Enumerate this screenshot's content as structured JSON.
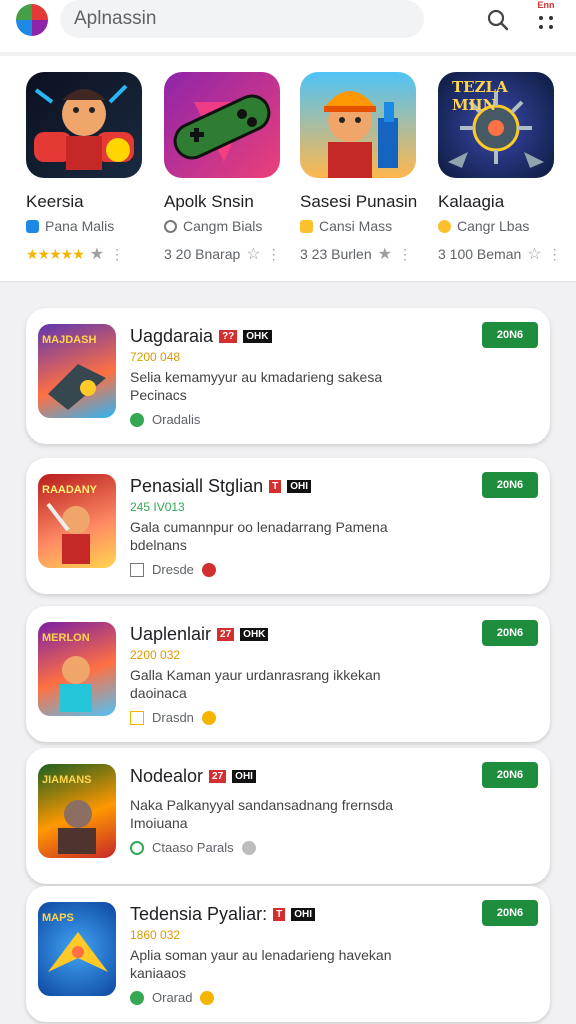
{
  "header": {
    "search_text": "Aplnassin",
    "menu_badge": "Enn",
    "icons": [
      "app-logo",
      "search-icon",
      "menu-icon"
    ]
  },
  "featured": [
    {
      "title": "Keersia",
      "developer": "Pana Malis",
      "size": "",
      "rating": 4,
      "colors": [
        "#0c1020",
        "#e53935",
        "#1e88e5"
      ]
    },
    {
      "title": "Apolk Snsin",
      "developer": "Cangm Bials",
      "size": "3 20 Bnarap",
      "rating": 0,
      "colors": [
        "#8e24aa",
        "#2e7d32",
        "#ff4081"
      ]
    },
    {
      "title": "Sasesi Punasin",
      "developer": "Cansi Mass",
      "size": "3 23 Burlen",
      "rating": 0,
      "colors": [
        "#4fc3f7",
        "#ff9800",
        "#c62828"
      ]
    },
    {
      "title": "Kalaagia",
      "developer": "Cangr Lbas",
      "size": "3 100 Beman",
      "rating": 0,
      "colors": [
        "#0d1b3e",
        "#5c6bc0",
        "#ffca28"
      ]
    }
  ],
  "list": [
    {
      "name": "Uagdaraia",
      "badge_red": "??",
      "badge_black": "OHK",
      "count": "7200 048",
      "desc": "Selia kemamyyur au kmadarieng sakesa Pecinacs",
      "sub": "Oradalis",
      "install": "20N6",
      "icon_label": "MAJDASH",
      "colors": [
        "#5e35b1",
        "#ff7043",
        "#29b6f6"
      ]
    },
    {
      "name": "Penasiall Stglian",
      "badge_red": "T",
      "badge_black": "OHI",
      "count": "245 IV013",
      "desc": "Gala cumannpur oo lenadarrang Pamena bdelnans",
      "sub": "Dresde",
      "install": "20N6",
      "icon_label": "RAADANY",
      "colors": [
        "#b71c1c",
        "#ff8a65",
        "#ffd54f"
      ]
    },
    {
      "name": "Uaplenlair",
      "badge_red": "27",
      "badge_black": "OHK",
      "count": "2200 032",
      "desc": "Galla Kaman yaur urdanrasrang ikkekan daoinaca",
      "sub": "Drasdn",
      "install": "20N6",
      "icon_label": "MERLON",
      "colors": [
        "#7b1fa2",
        "#ff7043",
        "#4fc3f7"
      ]
    },
    {
      "name": "Nodealor",
      "badge_red": "27",
      "badge_black": "OHI",
      "count": "",
      "desc": "Naka Palkanyyal sandansadnang frernsda Imoiuana",
      "sub": "Ctaaso Parals",
      "install": "20N6",
      "icon_label": "JIAMANS",
      "colors": [
        "#1b5e20",
        "#ff9800",
        "#c62828"
      ]
    },
    {
      "name": "Tedensia Pyaliar:",
      "badge_red": "T",
      "badge_black": "OHI",
      "count": "1860 032",
      "desc": "Aplia soman yaur au lenadarieng havekan kaniaaos",
      "sub": "Orarad",
      "install": "20N6",
      "icon_label": "MAPS",
      "colors": [
        "#0d47a1",
        "#42a5f5",
        "#ffca28"
      ]
    }
  ],
  "colors": {
    "accent": "#1e8e3e",
    "star": "#f4b400",
    "badge_red": "#d32f2f"
  }
}
